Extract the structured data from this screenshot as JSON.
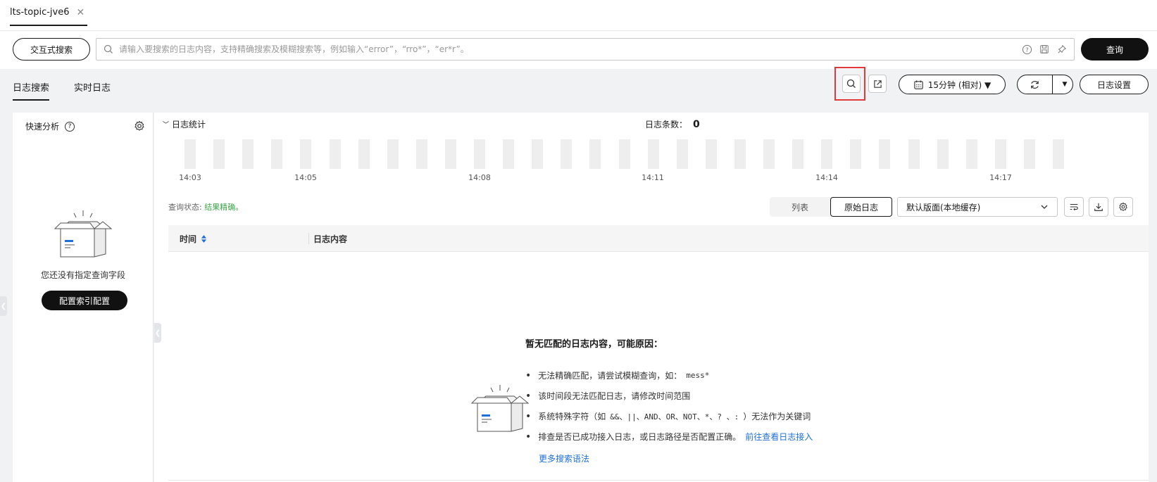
{
  "tab": {
    "label": "lts-topic-jve6"
  },
  "search": {
    "interactive_btn": "交互式搜索",
    "placeholder": "请输入要搜索的日志内容，支持精确搜索及模糊搜索等，例如输入“error”，“rro*”，“er*r”。",
    "query_btn": "查询"
  },
  "subtabs": {
    "log_search": "日志搜索",
    "realtime": "实时日志"
  },
  "toolbar": {
    "time_range": "15分钟 (相对) ▼",
    "log_settings": "日志设置"
  },
  "quick_analysis": {
    "title": "快速分析",
    "empty_text": "您还没有指定查询字段",
    "config_btn": "配置索引配置"
  },
  "stats": {
    "toggle_label": "日志统计",
    "count_label": "日志条数：",
    "count_value": "0",
    "time_ticks": [
      "14:03",
      "14:05",
      "14:08",
      "14:11",
      "14:14",
      "14:17"
    ]
  },
  "query_status": {
    "label": "查询状态: ",
    "value": "结果精确。"
  },
  "view": {
    "list": "列表",
    "raw": "原始日志",
    "layout": "默认版面(本地缓存)"
  },
  "table": {
    "col_time": "时间",
    "col_content": "日志内容"
  },
  "empty": {
    "title": "暂无匹配的日志内容，可能原因：",
    "reason1": "无法精确匹配，请尝试模糊查询，如：",
    "reason1_code": "mess*",
    "reason2": "该时间段无法匹配日志，请修改时间范围",
    "reason3_pre": "系统特殊字符（如",
    "reason3_code": "&&、||、AND、OR、NOT、*、? 、:",
    "reason3_post": "）无法作为关键词",
    "reason4": "排查是否已成功接入日志，或日志路径是否配置正确。",
    "reason4_link": "前往查看日志接入",
    "more_link": "更多搜索语法"
  },
  "colors": {
    "accent": "#1f6fd6",
    "success": "#3ba64a",
    "highlight": "#e03a3a",
    "dark": "#111111"
  }
}
